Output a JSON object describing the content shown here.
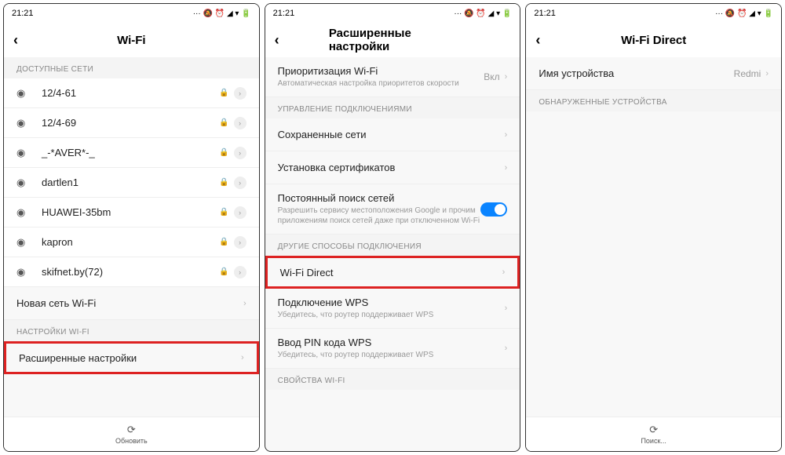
{
  "status_time": "21:21",
  "status_icons": "··· 🔕 ⏰ ◢ ▾ 🔋",
  "p1": {
    "title": "Wi-Fi",
    "sec_available": "ДОСТУПНЫЕ СЕТИ",
    "networks": [
      {
        "name": "12/4-61"
      },
      {
        "name": "12/4-69"
      },
      {
        "name": "_-*AVER*-_"
      },
      {
        "name": "dartlen1"
      },
      {
        "name": "HUAWEI-35bm"
      },
      {
        "name": "kapron"
      },
      {
        "name": "skifnet.by(72)"
      }
    ],
    "new_network": "Новая сеть Wi-Fi",
    "sec_settings": "НАСТРОЙКИ WI-FI",
    "advanced": "Расширенные настройки",
    "refresh": "Обновить"
  },
  "p2": {
    "title": "Расширенные настройки",
    "prio_title": "Приоритизация Wi-Fi",
    "prio_sub": "Автоматическая настройка приоритетов скорости",
    "prio_val": "Вкл",
    "sec_conn": "УПРАВЛЕНИЕ ПОДКЛЮЧЕНИЯМИ",
    "saved": "Сохраненные сети",
    "certs": "Установка сертификатов",
    "scan_title": "Постоянный поиск сетей",
    "scan_sub": "Разрешить сервису местоположения Google и прочим приложениям поиск сетей даже при отключенном Wi-Fi",
    "sec_other": "ДРУГИЕ СПОСОБЫ ПОДКЛЮЧЕНИЯ",
    "direct": "Wi-Fi Direct",
    "wps_title": "Подключение WPS",
    "wps_sub": "Убедитесь, что роутер поддерживает WPS",
    "pin_title": "Ввод PIN кода WPS",
    "pin_sub": "Убедитесь, что роутер поддерживает WPS",
    "sec_props": "СВОЙСТВА WI-FI"
  },
  "p3": {
    "title": "Wi-Fi Direct",
    "device_label": "Имя устройства",
    "device_value": "Redmi",
    "sec_found": "ОБНАРУЖЕННЫЕ УСТРОЙСТВА",
    "search": "Поиск..."
  }
}
